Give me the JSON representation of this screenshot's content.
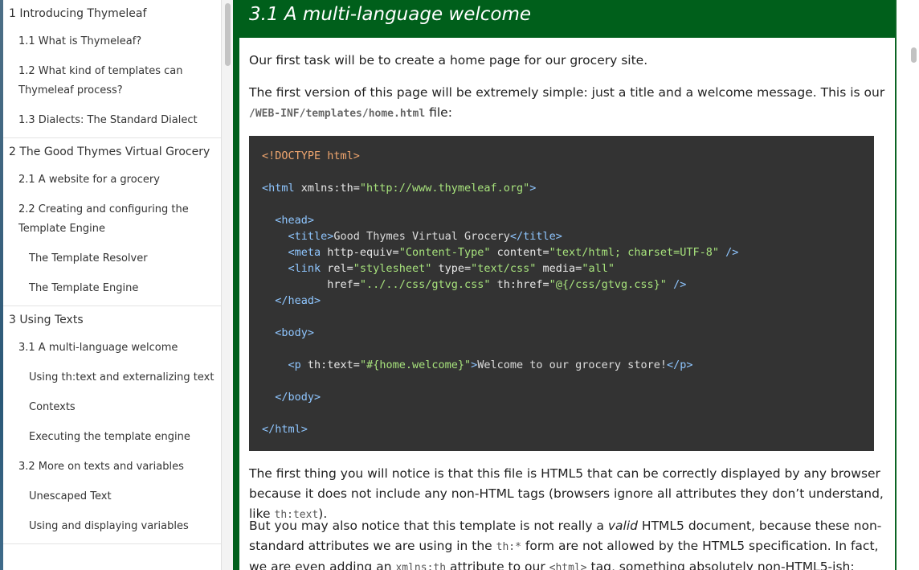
{
  "toc": {
    "items": [
      {
        "level": 1,
        "label": "1 Introducing Thymeleaf"
      },
      {
        "level": 2,
        "label": "1.1 What is Thymeleaf?"
      },
      {
        "level": 2,
        "label": "1.2 What kind of templates can Thymeleaf process?"
      },
      {
        "level": 2,
        "label": "1.3 Dialects: The Standard Dialect"
      },
      {
        "level": 1,
        "label": "2 The Good Thymes Virtual Grocery"
      },
      {
        "level": 2,
        "label": "2.1 A website for a grocery"
      },
      {
        "level": 2,
        "label": "2.2 Creating and configuring the Template Engine"
      },
      {
        "level": 3,
        "label": "The Template Resolver"
      },
      {
        "level": 3,
        "label": "The Template Engine"
      },
      {
        "level": 1,
        "label": "3 Using Texts"
      },
      {
        "level": 2,
        "label": "3.1 A multi-language welcome"
      },
      {
        "level": 3,
        "label": "Using th:text and externalizing text"
      },
      {
        "level": 3,
        "label": "Contexts"
      },
      {
        "level": 3,
        "label": "Executing the template engine"
      },
      {
        "level": 2,
        "label": "3.2 More on texts and variables"
      },
      {
        "level": 3,
        "label": "Unescaped Text"
      },
      {
        "level": 3,
        "label": "Using and displaying variables"
      }
    ]
  },
  "main": {
    "title": "3.1 A multi-language welcome",
    "p1": "Our first task will be to create a home page for our grocery site.",
    "p2_a": "The first version of this page will be extremely simple: just a title and a welcome message. This is our ",
    "p2_code": "/WEB-INF/templates/home.html",
    "p2_b": " file:",
    "p3_a": "The first thing you will notice is that this file is HTML5 that can be correctly displayed by any browser because it does not include any non-HTML tags (browsers ignore all attributes they don’t understand, like ",
    "p3_code": "th:text",
    "p3_b": ").",
    "p4_a": "But you may also notice that this template is not really a ",
    "p4_em": "valid",
    "p4_b": " HTML5 document, because these non-standard attributes we are using in the ",
    "p4_code1": "th:*",
    "p4_c": " form are not allowed by the HTML5 specification. In fact, we are even adding an ",
    "p4_code2": "xmlns:th",
    "p4_d": " attribute to our ",
    "p4_code3": "<html>",
    "p4_e": " tag, something absolutely non-HTML5-ish:"
  },
  "code": {
    "lines": [
      [
        {
          "t": "decl",
          "v": "<!DOCTYPE html>"
        }
      ],
      [],
      [
        {
          "t": "tag",
          "v": "<html"
        },
        {
          "t": "attr",
          "v": " xmlns:th="
        },
        {
          "t": "str",
          "v": "\"http://www.thymeleaf.org\""
        },
        {
          "t": "tag",
          "v": ">"
        }
      ],
      [],
      [
        {
          "t": "txt",
          "v": "  "
        },
        {
          "t": "tag",
          "v": "<head>"
        }
      ],
      [
        {
          "t": "txt",
          "v": "    "
        },
        {
          "t": "tag",
          "v": "<title>"
        },
        {
          "t": "txt",
          "v": "Good Thymes Virtual Grocery"
        },
        {
          "t": "tag",
          "v": "</title>"
        }
      ],
      [
        {
          "t": "txt",
          "v": "    "
        },
        {
          "t": "tag",
          "v": "<meta"
        },
        {
          "t": "attr",
          "v": " http-equiv="
        },
        {
          "t": "str",
          "v": "\"Content-Type\""
        },
        {
          "t": "attr",
          "v": " content="
        },
        {
          "t": "str",
          "v": "\"text/html; charset=UTF-8\""
        },
        {
          "t": "tag",
          "v": " />"
        }
      ],
      [
        {
          "t": "txt",
          "v": "    "
        },
        {
          "t": "tag",
          "v": "<link"
        },
        {
          "t": "attr",
          "v": " rel="
        },
        {
          "t": "str",
          "v": "\"stylesheet\""
        },
        {
          "t": "attr",
          "v": " type="
        },
        {
          "t": "str",
          "v": "\"text/css\""
        },
        {
          "t": "attr",
          "v": " media="
        },
        {
          "t": "str",
          "v": "\"all\""
        }
      ],
      [
        {
          "t": "txt",
          "v": "          "
        },
        {
          "t": "attr",
          "v": "href="
        },
        {
          "t": "str",
          "v": "\"../../css/gtvg.css\""
        },
        {
          "t": "attr",
          "v": " th:href="
        },
        {
          "t": "str",
          "v": "\"@{/css/gtvg.css}\""
        },
        {
          "t": "tag",
          "v": " />"
        }
      ],
      [
        {
          "t": "txt",
          "v": "  "
        },
        {
          "t": "tag",
          "v": "</head>"
        }
      ],
      [],
      [
        {
          "t": "txt",
          "v": "  "
        },
        {
          "t": "tag",
          "v": "<body>"
        }
      ],
      [],
      [
        {
          "t": "txt",
          "v": "    "
        },
        {
          "t": "tag",
          "v": "<p"
        },
        {
          "t": "attr",
          "v": " th:text="
        },
        {
          "t": "str",
          "v": "\"#{home.welcome}\""
        },
        {
          "t": "tag",
          "v": ">"
        },
        {
          "t": "txt",
          "v": "Welcome to our grocery store!"
        },
        {
          "t": "tag",
          "v": "</p>"
        }
      ],
      [],
      [
        {
          "t": "txt",
          "v": "  "
        },
        {
          "t": "tag",
          "v": "</body>"
        }
      ],
      [],
      [
        {
          "t": "tag",
          "v": "</html>"
        }
      ]
    ]
  },
  "colors": {
    "header_green": "#005f1b",
    "code_bg": "#333333"
  }
}
